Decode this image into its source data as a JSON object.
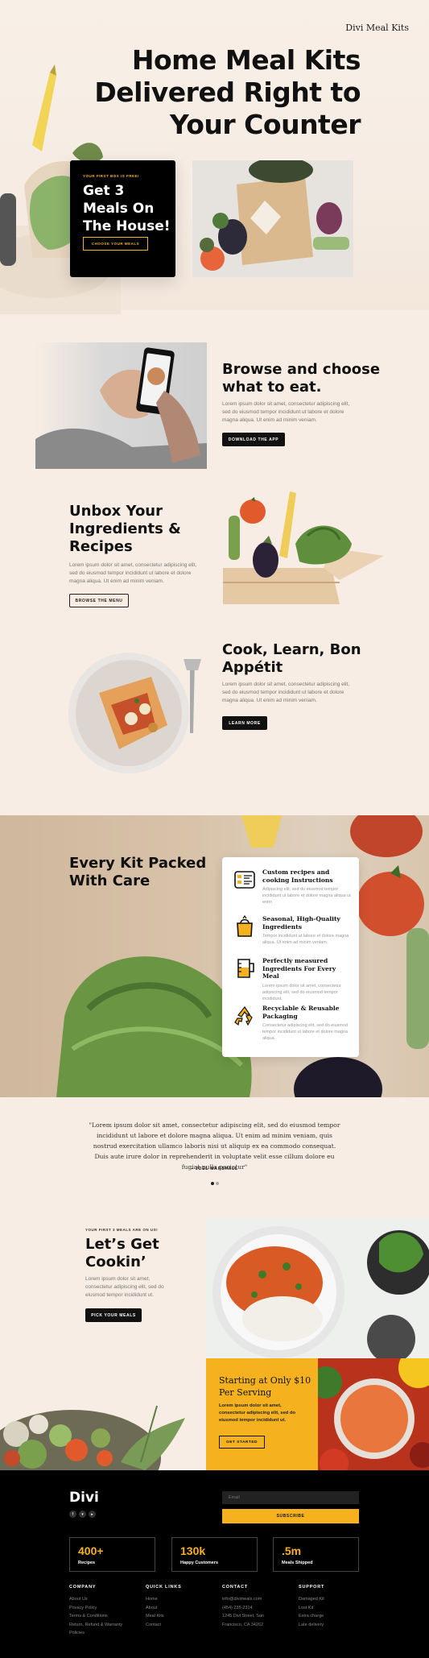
{
  "brand": "Divi Meal Kits",
  "hero": {
    "title_line1": "Home Meal Kits",
    "title_line2": "Delivered Right to",
    "title_line3": "Your Counter",
    "promo_kicker": "YOUR FIRST BOX IS FREE!",
    "promo_line1": "Get 3",
    "promo_line2": "Meals On",
    "promo_line3": "The House!",
    "promo_button": "CHOOSE YOUR MEALS"
  },
  "steps": [
    {
      "title_line1": "Browse and choose",
      "title_line2": "what to eat.",
      "text": "Lorem ipsum dolor sit amet, consectetur adipiscing elit, sed do eiusmod tempor incididunt ut labore et dolore magna aliqua. Ut enim ad minim veniam.",
      "button": "DOWNLOAD THE APP"
    },
    {
      "title_line1": "Unbox Your",
      "title_line2": "Ingredients &",
      "title_line3": "Recipes",
      "text": "Lorem ipsum dolor sit amet, consectetur adipiscing elit, sed do eiusmod tempor incididunt ut labore et dolore magna aliqua. Ut enim ad minim veniam.",
      "button": "BROWSE THE MENU"
    },
    {
      "title_line1": "Cook, Learn, Bon",
      "title_line2": "Appétit",
      "text": "Lorem ipsum dolor sit amet, consectetur adipiscing elit, sed do eiusmod tempor incididunt ut labore et dolore magna aliqua. Ut enim ad minim veniam.",
      "button": "LEARN MORE"
    }
  ],
  "pack": {
    "title_line1": "Every Kit Packed",
    "title_line2": "With Care",
    "features": [
      {
        "icon": "recipe-card-icon",
        "title": "Custom recipes and cooking Instructions",
        "text": "Adipiscing elit, sed do eiusmod tempor incididunt ut labore et dolore magna aliqua ut enim"
      },
      {
        "icon": "bag-icon",
        "title": "Seasonal, High-Quality Ingredients",
        "text": "Tempor incididunt ut labore et dolore magna aliqua. Ut enim ad minim veniam."
      },
      {
        "icon": "measuring-cup-icon",
        "title": "Perfectly measured Ingredients For Every Meal",
        "text": "Lorem ipsum dolor sit amet, consectetur adipiscing elit, sed do eiusmod tempor incididunt."
      },
      {
        "icon": "recycle-icon",
        "title": "Recyclable & Reusable Packaging",
        "text": "Consectetur adipiscing elit, sed do eiusmod tempor incididunt ut labore et dolore magna aliqua."
      }
    ]
  },
  "testimonial": {
    "quote": "\"Lorem ipsum dolor sit amet, consectetur adipiscing elit, sed do eiusmod tempor incididunt ut labore et dolore magna aliqua. Ut enim ad minim veniam, quis nostrud exercitation ullamco laboris nisi ut aliquip ex ea commodo consequat. Duis aute irure dolor in reprehenderit in voluptate velit esse cillum dolore eu fugiat nulla pariatur\"",
    "author": "– JOEL MARSHALL"
  },
  "cta": {
    "kicker": "YOUR FIRST 3 MEALS ARE ON US!",
    "title_line1": "Let’s Get",
    "title_line2": "Cookin’",
    "text": "Lorem ipsum dolor sit amet, consectetur adipiscing elit, sed do eiusmod tempor incididunt ut.",
    "button": "PICK YOUR MEALS",
    "price_title_line1": "Starting at Only $10",
    "price_title_line2": "Per Serving",
    "price_text": "Lorem ipsum dolor sit amet, consectetur adipiscing elit, sed do eiusmod tempor incididunt ut.",
    "price_button": "GET STARTED"
  },
  "footer": {
    "logo": "Divi",
    "email_placeholder": "Email",
    "subscribe": "SUBSCRIBE",
    "stats": [
      {
        "value": "400+",
        "label": "Recipes"
      },
      {
        "value": "130k",
        "label": "Happy Customers"
      },
      {
        "value": ".5m",
        "label": "Meals Shipped"
      }
    ],
    "columns": [
      {
        "heading": "COMPANY",
        "items": [
          "About Us",
          "Privacy Policy",
          "Terms & Conditions",
          "Return, Refund & Warranty",
          "Policies"
        ]
      },
      {
        "heading": "QUICK LINKS",
        "items": [
          "Home",
          "About",
          "Meal Kits",
          "Contact"
        ]
      },
      {
        "heading": "CONTACT",
        "items": [
          "info@divimeals.com",
          "(454) 235-2314",
          "1245 Divi Street, San",
          "Francisco, CA 34262"
        ]
      },
      {
        "heading": "SUPPORT",
        "items": [
          "Damaged Kit",
          "Lost Kit",
          "Extra charge",
          "Late delivery"
        ]
      }
    ]
  },
  "colors": {
    "accent": "#f5b21e",
    "dark": "#111111",
    "cream": "#f7ede4"
  }
}
